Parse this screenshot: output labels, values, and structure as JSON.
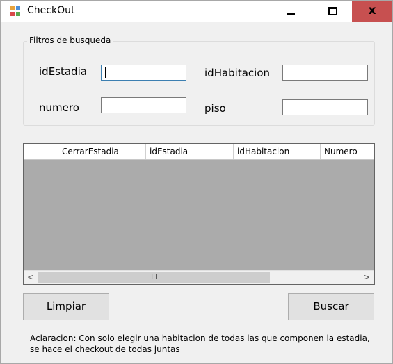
{
  "window": {
    "title": "CheckOut",
    "controls": {
      "minimize": "minimize-icon",
      "maximize": "maximize-icon",
      "close": "close-icon"
    },
    "close_glyph": "x"
  },
  "filters": {
    "legend": "Filtros de busqueda",
    "idEstadia": {
      "label": "idEstadia",
      "value": ""
    },
    "idHabitacion": {
      "label": "idHabitacion",
      "value": ""
    },
    "numero": {
      "label": "numero",
      "value": ""
    },
    "piso": {
      "label": "piso",
      "value": ""
    }
  },
  "grid": {
    "columns": [
      "",
      "CerrarEstadia",
      "idEstadia",
      "idHabitacion",
      "Numero"
    ],
    "rows": [],
    "scroll_left": "<",
    "scroll_right": ">",
    "grip": "III"
  },
  "buttons": {
    "limpiar": "Limpiar",
    "buscar": "Buscar"
  },
  "note": {
    "line1": "Aclaracion: Con solo elegir una habitacion de todas las que componen la estadia,",
    "line2": "se hace el checkout de todas juntas"
  },
  "colors": {
    "close_bg": "#c75050",
    "focus_border": "#3c7fb1",
    "grid_bg": "#ababab"
  }
}
